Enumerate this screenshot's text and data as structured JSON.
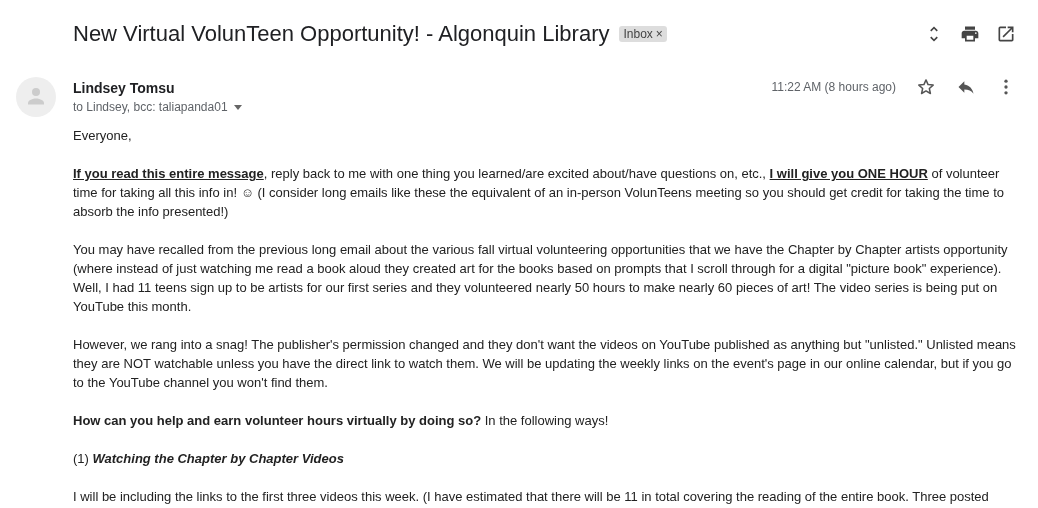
{
  "subject": "New Virtual VolunTeen Opportunity! - Algonquin Library",
  "label": {
    "text": "Inbox",
    "close": "×"
  },
  "sender": {
    "name": "Lindsey Tomsu",
    "recipients": "to Lindsey, bcc: taliapanda01",
    "time": "11:22 AM (8 hours ago)",
    "starred": false
  },
  "paragraphs": [
    {
      "kind": "plain",
      "text": "Everyone,"
    },
    {
      "kind": "underlined",
      "text": "**If you read this entire message**, reply back to me with one thing you learned/are excited about/have questions on, etc., **I will give you ONE HOUR** of volunteer time for taking all this info in! ☺  (I consider long emails like these the equivalent of an in-person VolunTeens meeting so you should get credit for taking the time to absorb the info presented!)"
    },
    {
      "kind": "plain",
      "text": "You may have recalled from the previous long email about the various fall virtual volunteering opportunities that we have the Chapter by Chapter artists opportunity (where instead of just watching me read a book aloud they created art for the books based on prompts that I scroll through for a digital \"picture book\" experience). Well, I had 11 teens sign up to be artists for our first series and they volunteered nearly 50 hours to make nearly 60 pieces of art! The video series is being put on YouTube this month."
    },
    {
      "kind": "plain",
      "text": "However, we rang into a snag! The publisher's permission changed and they don't want the videos on YouTube published as anything but \"unlisted.\" Unlisted means they are NOT watchable unless you have the direct link to watch them. We will be updating the weekly links on the event's page in our online calendar, but if you go to the YouTube channel you won't find them."
    },
    {
      "kind": "plain",
      "text": "**How can you help and earn volunteer hours virtually by doing so?** In the following ways!"
    },
    {
      "kind": "heading",
      "text": "(1) *Watching the Chapter by Chapter Videos*"
    },
    {
      "kind": "plain",
      "text": "I will be including the links to the first three videos this week. (I have estimated that there will be 11 in total covering the reading of the entire book. Three posted"
    }
  ]
}
